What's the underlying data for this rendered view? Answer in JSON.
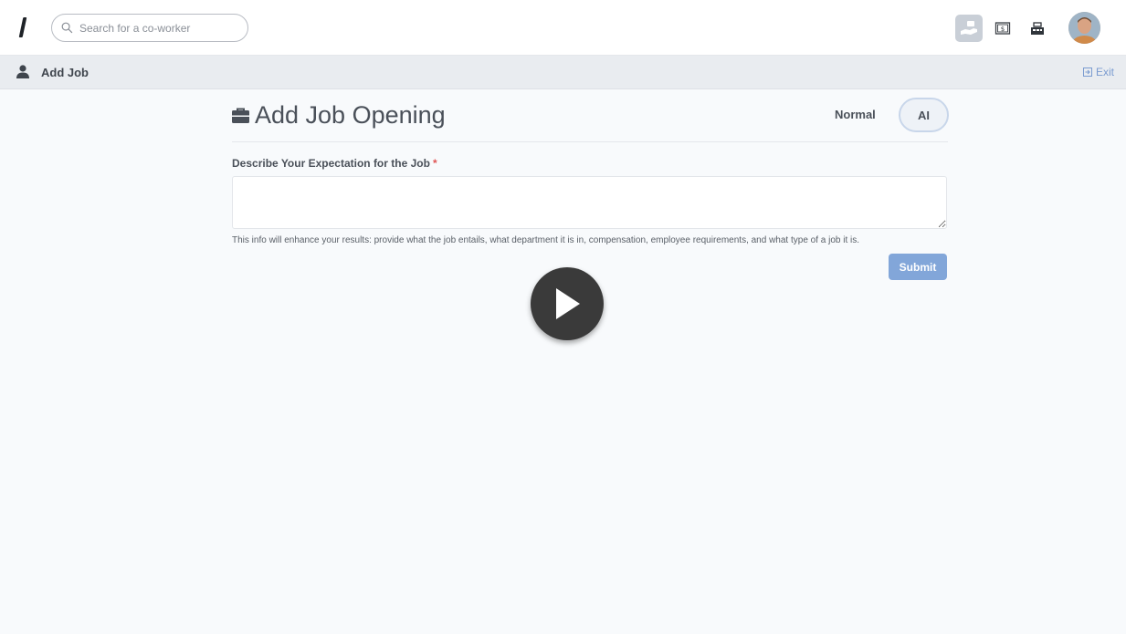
{
  "topbar": {
    "search": {
      "placeholder": "Search for a co-worker",
      "value": ""
    },
    "icons": [
      "hand-money-icon",
      "dollar-bill-icon",
      "cash-register-icon"
    ],
    "avatar": "user-avatar"
  },
  "subbar": {
    "title": "Add Job",
    "exit_label": "Exit"
  },
  "page": {
    "title": "Add Job Opening",
    "modes": {
      "normal": "Normal",
      "ai": "AI",
      "selected": "AI"
    },
    "field": {
      "label": "Describe Your Expectation for the Job",
      "required_mark": "*",
      "value": "",
      "help": "This info will enhance your results: provide what the job entails, what department it is in, compensation, employee requirements, and what type of a job it is."
    },
    "submit_label": "Submit"
  },
  "colors": {
    "accent": "#82a6d9",
    "link": "#7a9bd0",
    "required": "#e05454",
    "background": "#f8fafc"
  }
}
